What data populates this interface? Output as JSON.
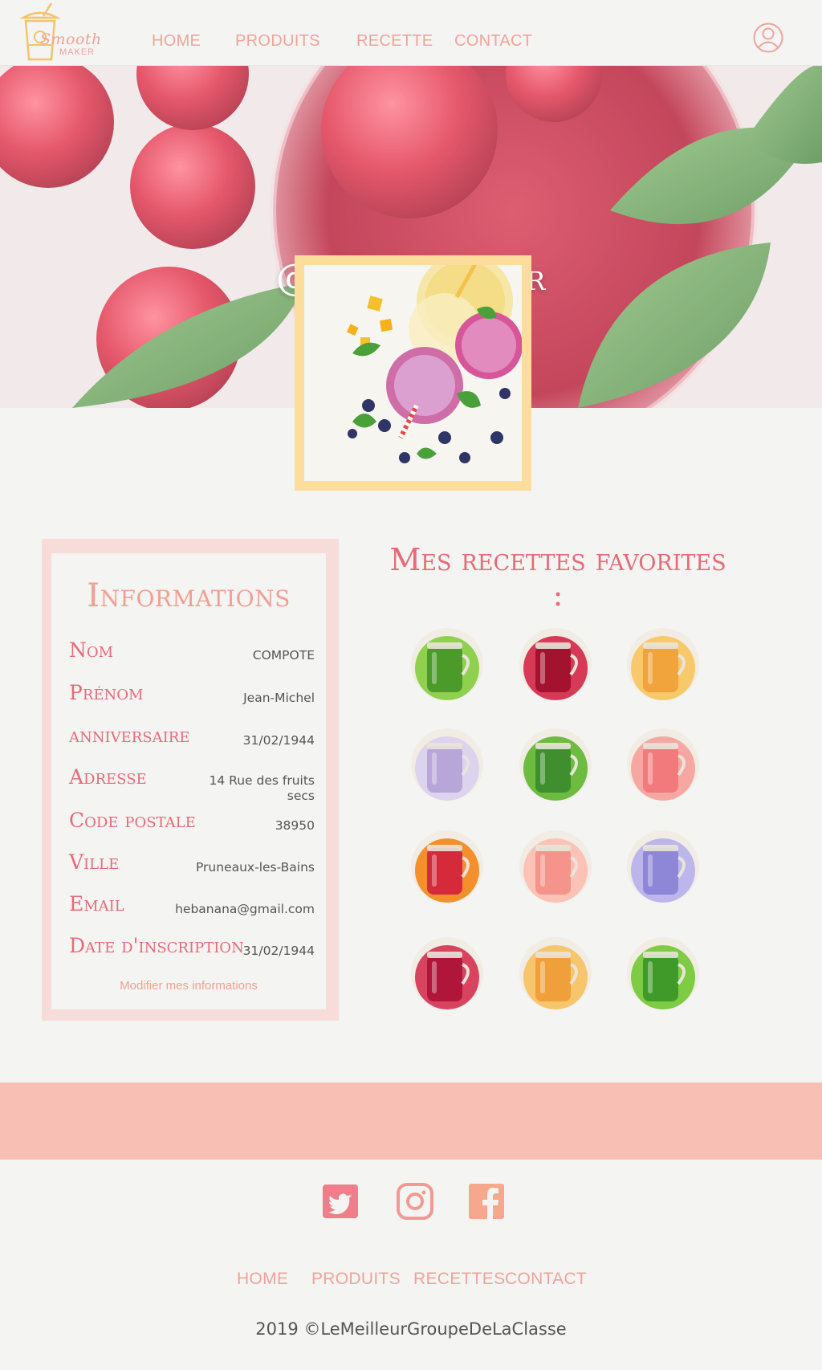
{
  "brand": {
    "script": "Smooth",
    "sub": "MAKER"
  },
  "nav": {
    "home": "HOME",
    "produits": "PRODUITS",
    "recette": "RECETTE",
    "contact": "CONTACT"
  },
  "profile": {
    "pseudo": "@Pseudo-User"
  },
  "info": {
    "title": "Informations",
    "rows": [
      {
        "label": "Nom",
        "value": "COMPOTE"
      },
      {
        "label": "Prénom",
        "value": "Jean-Michel"
      },
      {
        "label": "anniversaire",
        "value": "31/02/1944"
      },
      {
        "label": "Adresse",
        "value": "14 Rue des fruits secs"
      },
      {
        "label": "Code postale",
        "value": "38950"
      },
      {
        "label": "Ville",
        "value": "Pruneaux-les-Bains"
      },
      {
        "label": "Email",
        "value": "hebanana@gmail.com"
      },
      {
        "label": "Date d'inscription",
        "value": "31/02/1944"
      }
    ],
    "edit_label": "Modifier mes informations"
  },
  "favorites": {
    "title": "Mes recettes favorites :",
    "items": [
      {
        "name": "green-smoothie",
        "color": "#4c9a2a",
        "accent": "#8fd14f"
      },
      {
        "name": "berry-smoothie",
        "color": "#a3122f",
        "accent": "#d63a56"
      },
      {
        "name": "mango-smoothie",
        "color": "#f0a43b",
        "accent": "#f7c96b"
      },
      {
        "name": "blueberry-smoothie",
        "color": "#b8a6d9",
        "accent": "#dcd3ef"
      },
      {
        "name": "kiwi-smoothie",
        "color": "#3f8f2f",
        "accent": "#6dbb3f"
      },
      {
        "name": "watermelon-smoothie",
        "color": "#f27a7c",
        "accent": "#f6a7a1"
      },
      {
        "name": "red-orange-smoothie",
        "color": "#d52a3a",
        "accent": "#f3902c"
      },
      {
        "name": "grapefruit-smoothie",
        "color": "#f4948a",
        "accent": "#fbc2b5"
      },
      {
        "name": "lavender-smoothie",
        "color": "#8e86d6",
        "accent": "#bdb6ec"
      },
      {
        "name": "raspberry-smoothie",
        "color": "#b0163a",
        "accent": "#d8435f"
      },
      {
        "name": "peach-smoothie",
        "color": "#f0a03a",
        "accent": "#f6c56c"
      },
      {
        "name": "spinach-smoothie",
        "color": "#3f9a2a",
        "accent": "#7dcc44"
      }
    ]
  },
  "footer": {
    "home": "HOME",
    "produits": "PRODUITS",
    "recettes": "RECETTES",
    "contact": "CONTACT",
    "copyright": "2019 ©LeMeilleurGroupeDeLaClasse"
  },
  "colors": {
    "accent": "#f1a39a",
    "accent_strong": "#e86a78",
    "frame_yellow": "#fddd9b",
    "band_pink": "#f8bfb5",
    "twitter": "#ef7d8a",
    "instagram": "#f19a93",
    "facebook": "#f7a88c"
  }
}
